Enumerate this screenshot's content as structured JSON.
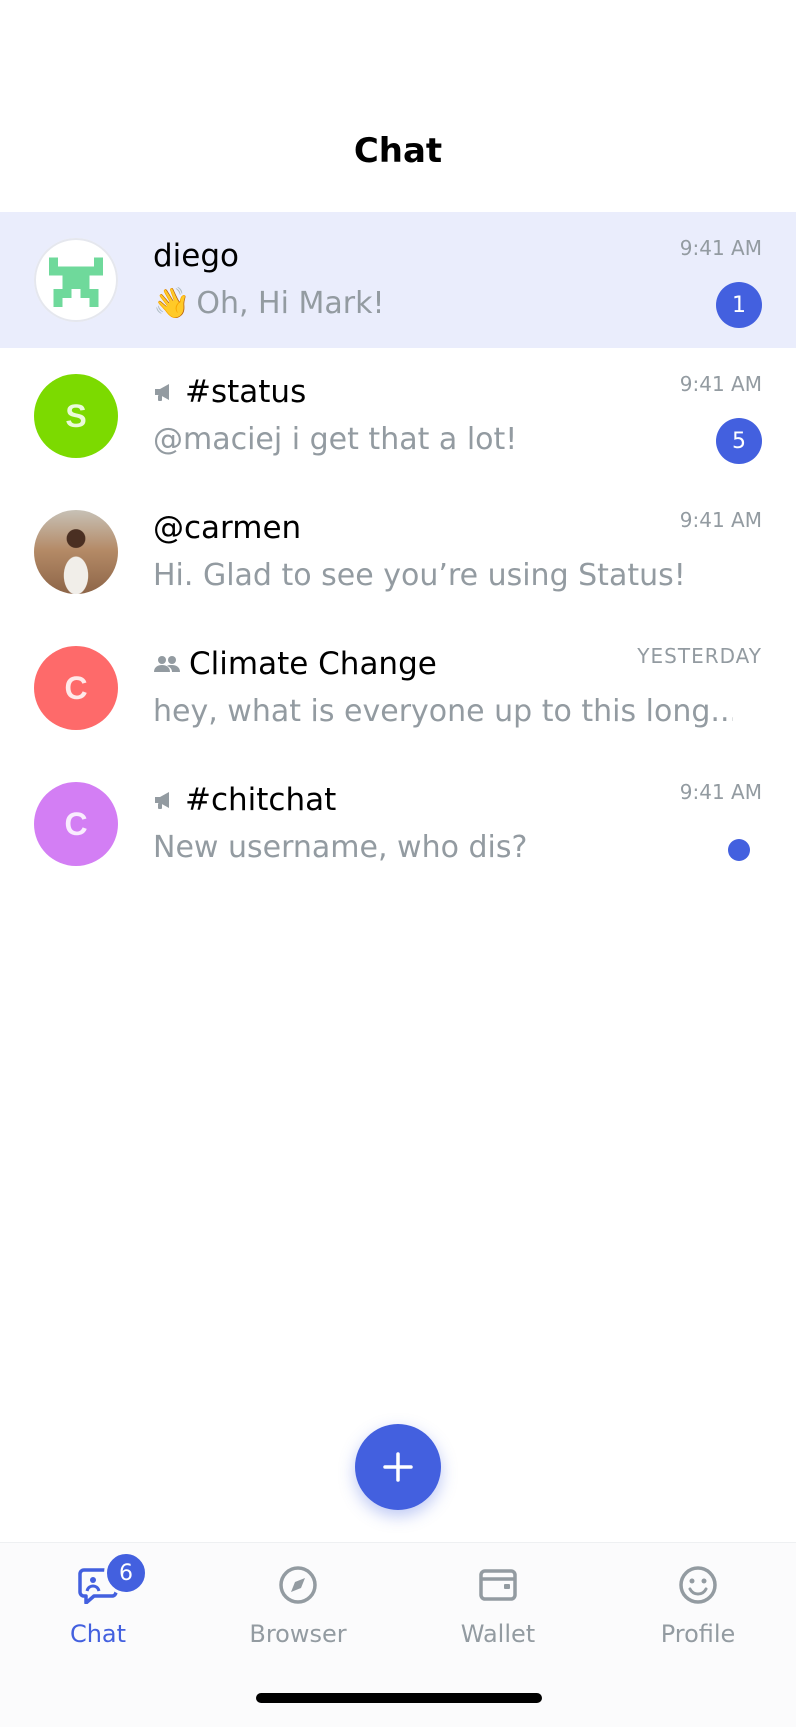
{
  "header": {
    "title": "Chat"
  },
  "chats": [
    {
      "name": "diego",
      "emoji": "👋",
      "message": "Oh, Hi Mark!",
      "time": "9:41 AM",
      "badge": "1"
    },
    {
      "name": "#status",
      "message": "@maciej i get that a lot!",
      "time": "9:41 AM",
      "badge": "5",
      "avatar_letter": "S"
    },
    {
      "name": "@carmen",
      "message": "Hi. Glad to see you’re using Status!",
      "time": "9:41 AM"
    },
    {
      "name": "Climate Change",
      "message": "hey, what is everyone up to this long...",
      "time": "YESTERDAY",
      "avatar_letter": "C"
    },
    {
      "name": "#chitchat",
      "message": "New username, who dis?",
      "time": "9:41 AM",
      "avatar_letter": "C"
    }
  ],
  "colors": {
    "accent": "#4360df",
    "highlight_row": "#eaedfc",
    "avatar_status": "#7cda00",
    "avatar_climate": "#fe6a6a",
    "avatar_chitchat": "#d37ef4",
    "identicon": "#6fd99b",
    "muted_text": "#939ba1"
  },
  "tabs": [
    {
      "label": "Chat",
      "icon": "chat-icon",
      "badge": "6",
      "active": true
    },
    {
      "label": "Browser",
      "icon": "compass-icon"
    },
    {
      "label": "Wallet",
      "icon": "wallet-icon"
    },
    {
      "label": "Profile",
      "icon": "smiley-icon"
    }
  ],
  "fab": {
    "icon": "plus-icon"
  }
}
